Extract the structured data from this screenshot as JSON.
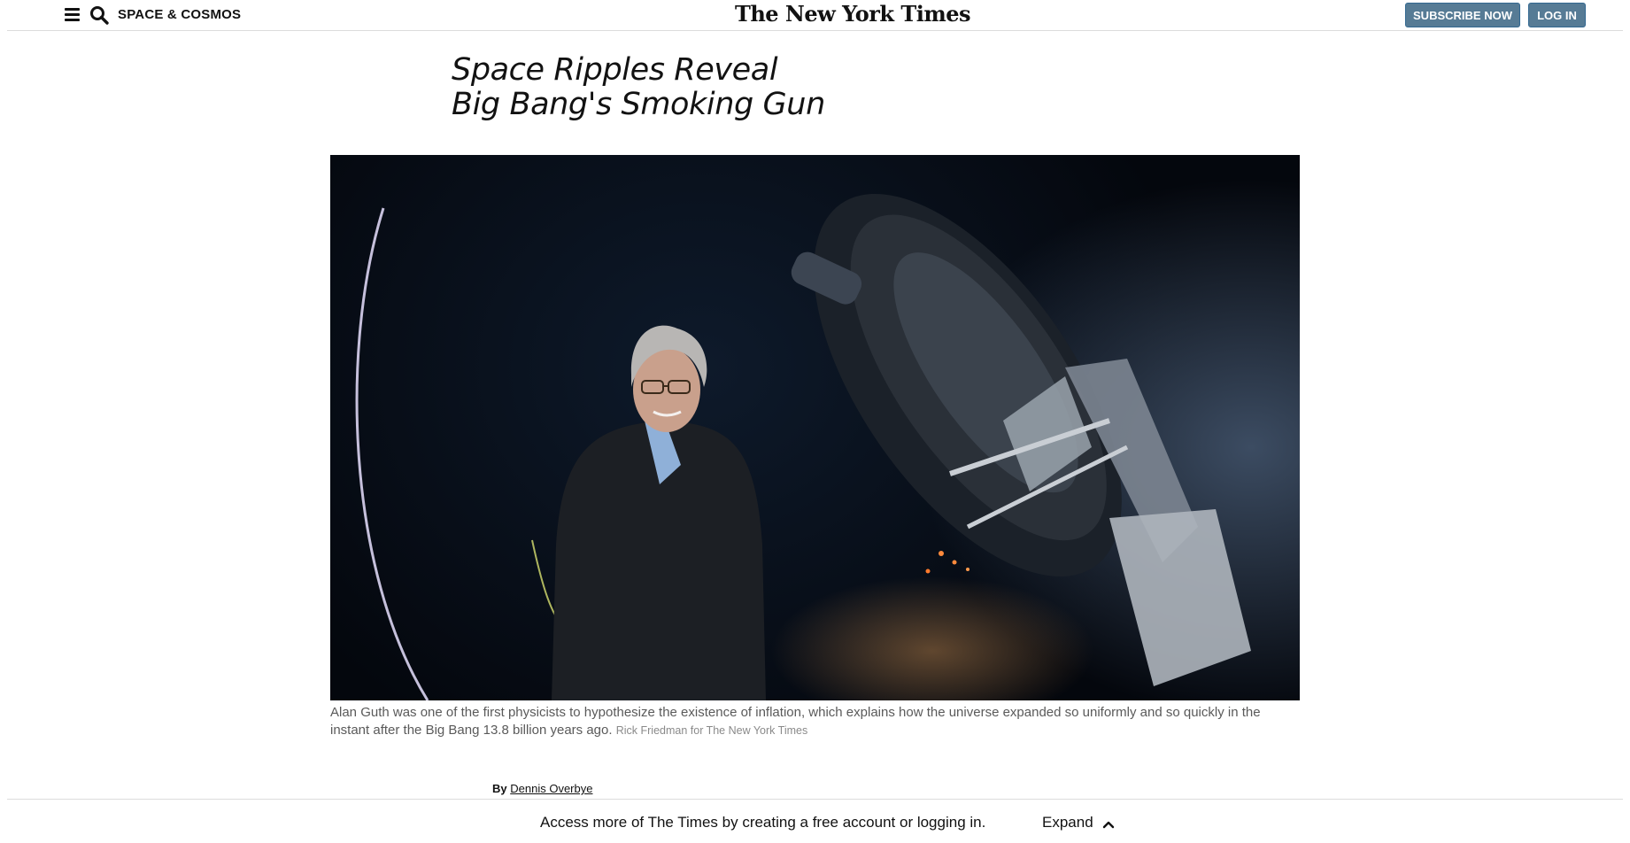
{
  "header": {
    "section_label": "SPACE & COSMOS",
    "logo_text": "The New York Times",
    "subscribe_label": "SUBSCRIBE NOW",
    "login_label": "LOG IN",
    "menu_icon": "hamburger-menu-icon",
    "search_icon": "search-icon",
    "button_color": "#567b95"
  },
  "article": {
    "headline_line1": "Space Ripples Reveal",
    "headline_line2": "Big Bang's Smoking Gun",
    "photo_alt": "Alan Guth standing beside a telescope at night",
    "caption": "Alan Guth was one of the first physicists to hypothesize the existence of inflation, which explains how the universe expanded so uniformly and so quickly in the instant after the Big Bang 13.8 billion years ago.",
    "credit": "Rick Friedman for The New York Times",
    "byline_prefix": "By",
    "author": "Dennis Overbye"
  },
  "banner": {
    "message": "Access more of The Times by creating a free account or logging in.",
    "expand_label": "Expand",
    "expand_icon": "chevron-up-icon"
  }
}
